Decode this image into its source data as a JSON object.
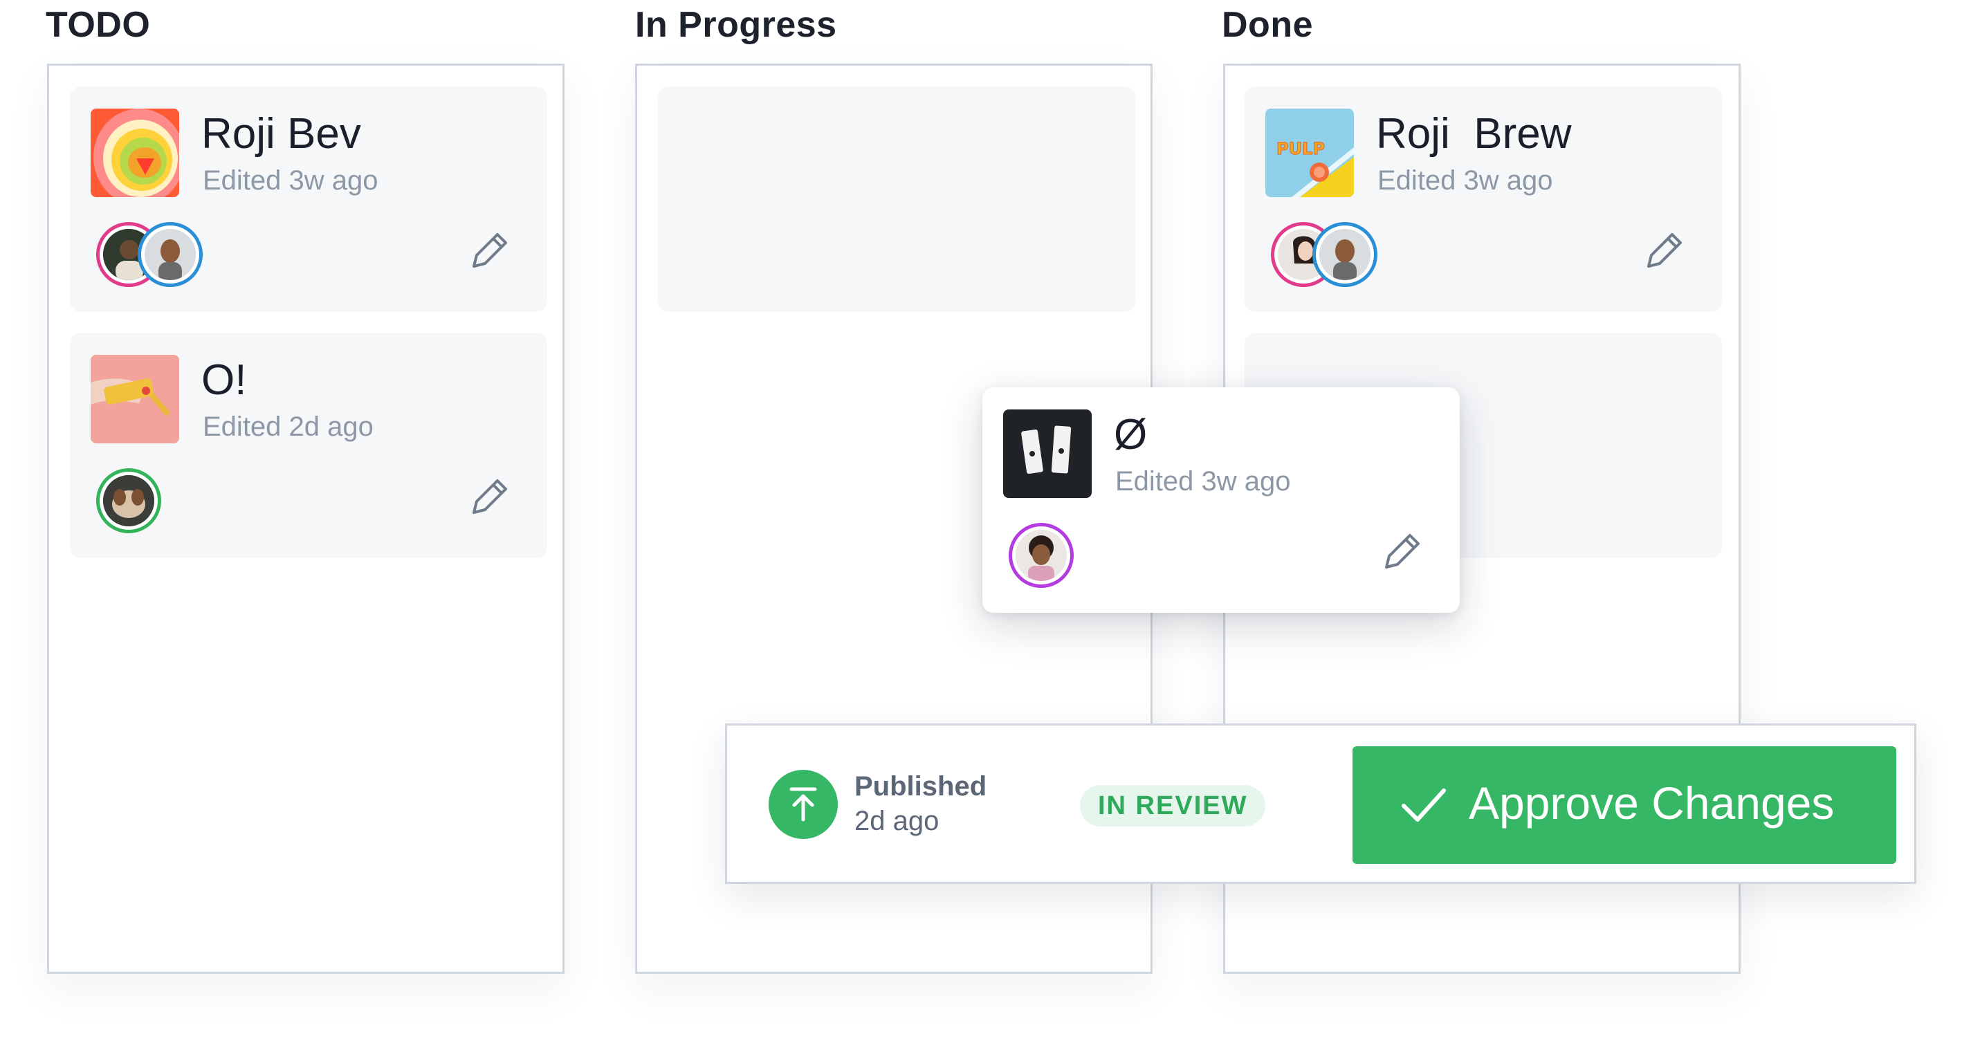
{
  "columns": [
    {
      "title": "TODO"
    },
    {
      "title": "In Progress"
    },
    {
      "title": "Done"
    }
  ],
  "cards": {
    "todo_1": {
      "title": "Roji Bev",
      "edited": "Edited 3w ago"
    },
    "todo_2": {
      "title": "O!",
      "edited": "Edited 2d ago"
    },
    "done_1": {
      "title": "Roji  Brew",
      "edited": "Edited 3w ago",
      "thumb_text": "PULP"
    },
    "dragging": {
      "title": "Ø",
      "edited": "Edited 3w ago"
    }
  },
  "review_bar": {
    "published_label": "Published",
    "published_time": "2d ago",
    "status_badge": "IN REVIEW",
    "approve_label": "Approve Changes"
  },
  "colors": {
    "accent_green": "#35b765",
    "badge_bg": "#e6f6ec",
    "avatar_pink": "#e23b8a",
    "avatar_blue": "#2b8fd6",
    "avatar_green": "#33b35a",
    "avatar_purple": "#b43be0"
  },
  "icons": [
    "pencil-icon",
    "upload-arrow-icon",
    "checkmark-icon"
  ]
}
